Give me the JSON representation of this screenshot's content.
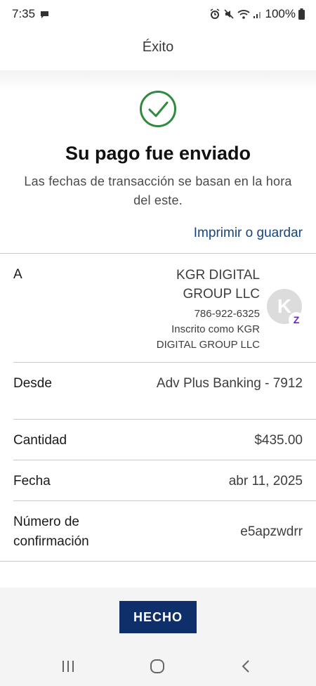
{
  "status_bar": {
    "time": "7:35",
    "battery": "100%"
  },
  "header": {
    "title": "Éxito"
  },
  "confirmation": {
    "headline": "Su pago fue enviado",
    "subtext": "Las fechas de transacción se basan en la hora del este.",
    "print_link": "Imprimir o guardar"
  },
  "details": {
    "to": {
      "label": "A",
      "name_line1": "KGR DIGITAL",
      "name_line2": "GROUP LLC",
      "phone": "786-922-6325",
      "enrolled_line1": "Inscrito como KGR",
      "enrolled_line2": "DIGITAL GROUP LLC",
      "avatar_letter": "K",
      "badge_glyph": "Z"
    },
    "from": {
      "label": "Desde",
      "value": "Adv Plus Banking - 7912"
    },
    "amount": {
      "label": "Cantidad",
      "value": "$435.00"
    },
    "date": {
      "label": "Fecha",
      "value": "abr 11, 2025"
    },
    "confirmation_number": {
      "label_line1": "Número de",
      "label_line2": "confirmación",
      "value": "e5apzwdrr"
    }
  },
  "actions": {
    "done_label": "HECHO"
  },
  "colors": {
    "success_green": "#2e8b3e",
    "link_blue": "#17457f",
    "button_navy": "#0f2f6a",
    "zelle_purple": "#6d1ed4"
  },
  "icons": {
    "success": "check-circle-icon",
    "recent_apps": "recent-apps-icon",
    "home": "home-icon",
    "back": "back-icon"
  }
}
